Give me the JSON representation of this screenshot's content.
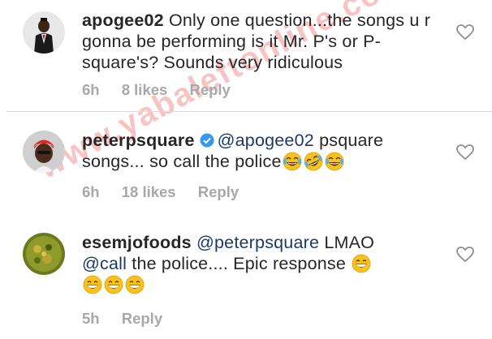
{
  "watermark": "www.yabaleftonline.com",
  "comments": [
    {
      "username": "apogee02",
      "text": " Only one question...the songs u r gonna be performing is it Mr. P's or P-square's? Sounds very ridiculous",
      "time": "6h",
      "likes": "8 likes",
      "reply": "Reply",
      "avatar_icon": "avatar-man-suit"
    },
    {
      "username": "peterpsquare",
      "verified": true,
      "mention": "@apogee02",
      "text": " psquare songs... so call the police",
      "emojis": [
        "joy-emoji",
        "rofl-emoji",
        "joy-emoji"
      ],
      "time": "6h",
      "likes": "18 likes",
      "reply": "Reply",
      "avatar_icon": "avatar-red-cap"
    },
    {
      "username": "esemjofoods",
      "mention1": "@peterpsquare",
      "text1": " LMAO",
      "mention2": "@call",
      "text2": " the police.... Epic response ",
      "emojis": [
        "grin-emoji",
        "grin-emoji",
        "grin-emoji",
        "grin-emoji"
      ],
      "time": "5h",
      "reply": "Reply",
      "avatar_icon": "avatar-food"
    }
  ],
  "colors": {
    "text": "#262626",
    "meta": "#a8a8a8",
    "mention": "#1a3a6b",
    "verified": "#3897f0",
    "watermark": "#e62828"
  }
}
